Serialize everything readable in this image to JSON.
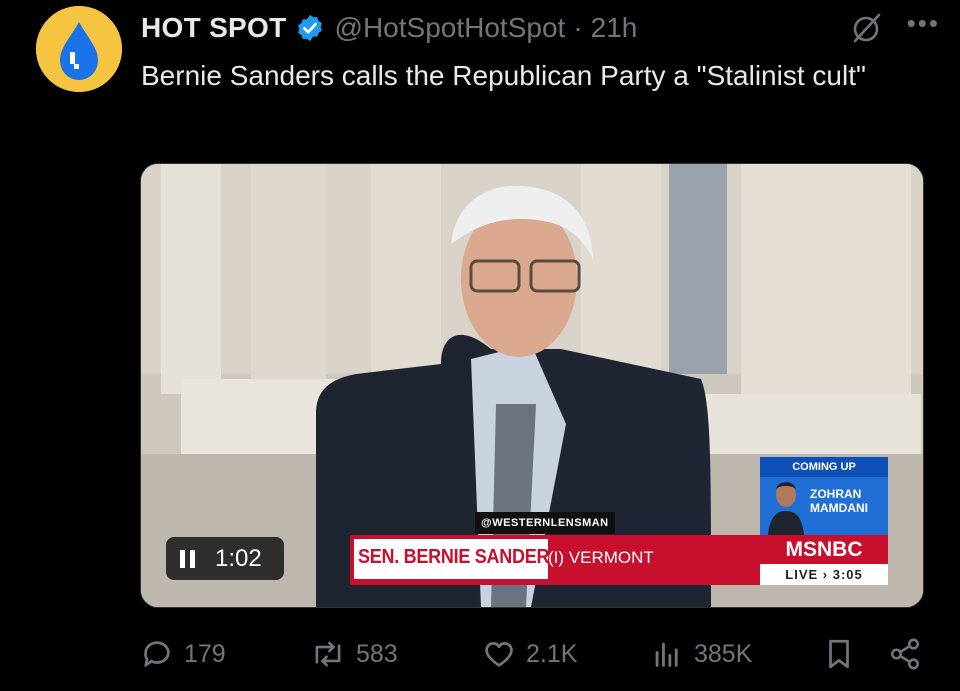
{
  "author": {
    "display_name": "HOT SPOT",
    "handle": "@HotSpotHotSpot",
    "separator": "·",
    "time": "21h"
  },
  "tweet": {
    "text": "Bernie Sanders calls the Republican Party a \"Stalinist cult\""
  },
  "video": {
    "watermark": "@WESTERNLENSMAN",
    "lower_third_name": "SEN. BERNIE SANDERS",
    "lower_third_state": "(I) VERMONT",
    "network": "MSNBC",
    "live_label": "LIVE › 3:05",
    "coming_up_label": "COMING UP",
    "coming_up_name": "ZOHRAN MAMDANI",
    "duration": "1:02"
  },
  "actions": {
    "replies": "179",
    "reposts": "583",
    "likes": "2.1K",
    "views": "385K"
  },
  "icons": {
    "verified": "verified-badge-icon",
    "grok": "grok-icon",
    "more": "more-icon",
    "reply": "reply-icon",
    "repost": "repost-icon",
    "like": "heart-icon",
    "views": "views-icon",
    "bookmark": "bookmark-icon",
    "share": "share-icon"
  },
  "colors": {
    "background": "#000000",
    "text": "#e7e9ea",
    "muted": "#71767b",
    "verified": "#1d9bf0",
    "msnbc_red": "#c8102e"
  }
}
